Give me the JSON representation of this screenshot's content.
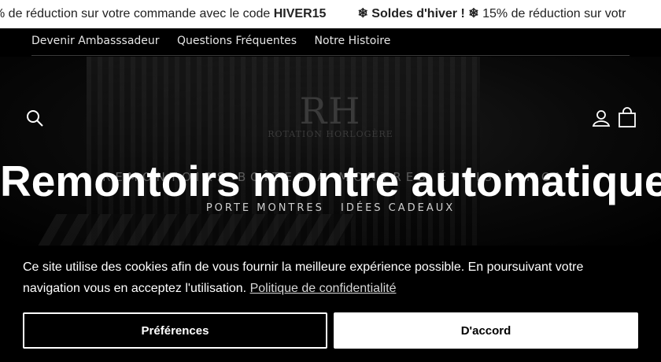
{
  "announcement": {
    "segments": [
      {
        "prefix": "% de réduction sur votre commande avec le code ",
        "code": "HIVER15"
      },
      {
        "prefix": "❄ Soldes d'hiver ! ❄",
        "suffix": " 15% de réduction sur votr"
      }
    ]
  },
  "topnav": {
    "items": [
      "Devenir Ambasssadeur",
      "Questions Fréquentes",
      "Notre Histoire"
    ]
  },
  "header": {
    "logo_mark": "RH",
    "logo_text": "ROTATION HORLOGÈRE",
    "ghost_nav": "REMONTOIRS   BOÎTES À MONTRES   ÉTUIS À MONTRES"
  },
  "hero": {
    "title": "Remontoirs montre automatique",
    "subnav": [
      "PORTE MONTRES",
      "IDÉES CADEAUX"
    ]
  },
  "cookie": {
    "text": "Ce site utilise des cookies afin de vous fournir la meilleure expérience possible. En poursuivant votre navigation vous en acceptez l'utilisation.",
    "policy_link": "Politique de confidentialité",
    "prefs_button": "Préférences",
    "accept_button": "D'accord"
  },
  "icons": {
    "search": "search-icon",
    "account": "account-icon",
    "cart": "cart-icon"
  }
}
